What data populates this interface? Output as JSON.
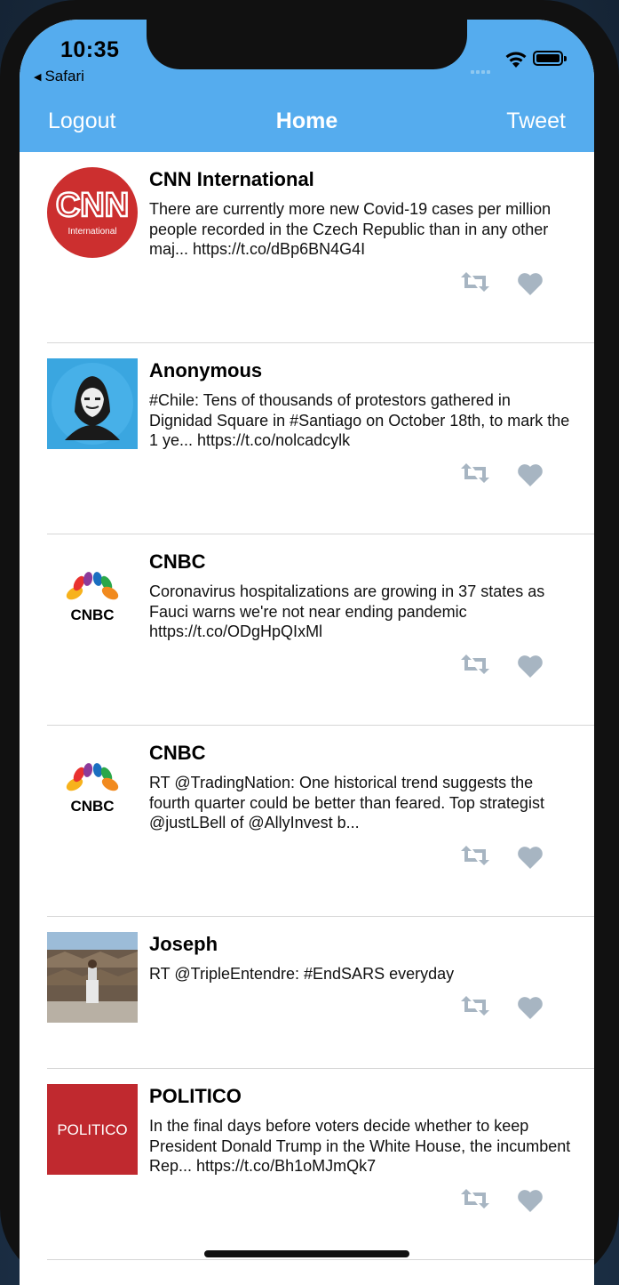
{
  "status": {
    "time": "10:35",
    "back_app": "Safari"
  },
  "nav": {
    "left": "Logout",
    "title": "Home",
    "right": "Tweet"
  },
  "tweets": [
    {
      "name": "CNN International",
      "text": "There are currently more new Covid-19 cases per million people recorded in the Czech Republic than in any other maj... https://t.co/dBp6BN4G4I",
      "avatar": "CNN",
      "avatar_sub": "International"
    },
    {
      "name": "Anonymous",
      "text": "#Chile:  Tens of thousands of protestors gathered in Dignidad Square in #Santiago on October 18th, to mark the 1 ye... https://t.co/nolcadcylk"
    },
    {
      "name": "CNBC",
      "text": "Coronavirus hospitalizations are growing in 37 states as Fauci warns we're not near ending pandemic https://t.co/ODgHpQIxMl",
      "avatar": "CNBC"
    },
    {
      "name": "CNBC",
      "text": "RT @TradingNation: One historical trend suggests the fourth quarter could be better than feared. Top strategist @justLBell of @AllyInvest b...",
      "avatar": "CNBC"
    },
    {
      "name": "Joseph",
      "text": "RT @TripleEntendre: #EndSARS everyday"
    },
    {
      "name": "POLITICO",
      "text": "In the final days before voters decide whether to keep President Donald Trump in the White House, the incumbent Rep... https://t.co/Bh1oMJmQk7",
      "avatar": "POLITICO"
    }
  ],
  "colors": {
    "nav": "#55acee",
    "icon": "#a7b5c2",
    "cnn": "#cc2f2f",
    "politico": "#c0292f"
  }
}
